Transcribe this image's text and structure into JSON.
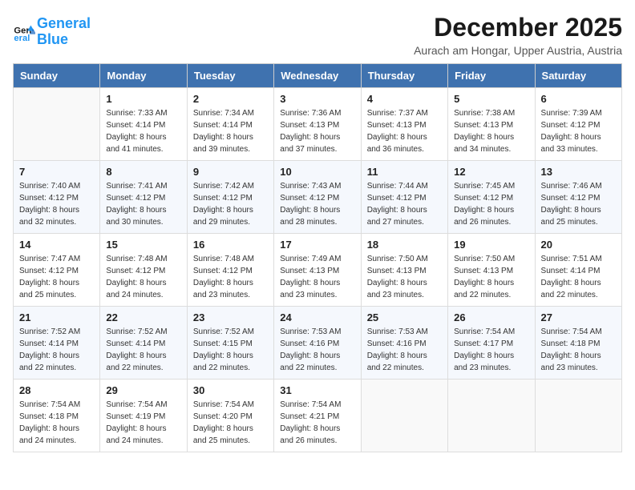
{
  "logo": {
    "line1": "General",
    "line2": "Blue"
  },
  "title": "December 2025",
  "subtitle": "Aurach am Hongar, Upper Austria, Austria",
  "days_of_week": [
    "Sunday",
    "Monday",
    "Tuesday",
    "Wednesday",
    "Thursday",
    "Friday",
    "Saturday"
  ],
  "weeks": [
    [
      {
        "day": "",
        "sunrise": "",
        "sunset": "",
        "daylight": ""
      },
      {
        "day": "1",
        "sunrise": "Sunrise: 7:33 AM",
        "sunset": "Sunset: 4:14 PM",
        "daylight": "Daylight: 8 hours and 41 minutes."
      },
      {
        "day": "2",
        "sunrise": "Sunrise: 7:34 AM",
        "sunset": "Sunset: 4:14 PM",
        "daylight": "Daylight: 8 hours and 39 minutes."
      },
      {
        "day": "3",
        "sunrise": "Sunrise: 7:36 AM",
        "sunset": "Sunset: 4:13 PM",
        "daylight": "Daylight: 8 hours and 37 minutes."
      },
      {
        "day": "4",
        "sunrise": "Sunrise: 7:37 AM",
        "sunset": "Sunset: 4:13 PM",
        "daylight": "Daylight: 8 hours and 36 minutes."
      },
      {
        "day": "5",
        "sunrise": "Sunrise: 7:38 AM",
        "sunset": "Sunset: 4:13 PM",
        "daylight": "Daylight: 8 hours and 34 minutes."
      },
      {
        "day": "6",
        "sunrise": "Sunrise: 7:39 AM",
        "sunset": "Sunset: 4:12 PM",
        "daylight": "Daylight: 8 hours and 33 minutes."
      }
    ],
    [
      {
        "day": "7",
        "sunrise": "Sunrise: 7:40 AM",
        "sunset": "Sunset: 4:12 PM",
        "daylight": "Daylight: 8 hours and 32 minutes."
      },
      {
        "day": "8",
        "sunrise": "Sunrise: 7:41 AM",
        "sunset": "Sunset: 4:12 PM",
        "daylight": "Daylight: 8 hours and 30 minutes."
      },
      {
        "day": "9",
        "sunrise": "Sunrise: 7:42 AM",
        "sunset": "Sunset: 4:12 PM",
        "daylight": "Daylight: 8 hours and 29 minutes."
      },
      {
        "day": "10",
        "sunrise": "Sunrise: 7:43 AM",
        "sunset": "Sunset: 4:12 PM",
        "daylight": "Daylight: 8 hours and 28 minutes."
      },
      {
        "day": "11",
        "sunrise": "Sunrise: 7:44 AM",
        "sunset": "Sunset: 4:12 PM",
        "daylight": "Daylight: 8 hours and 27 minutes."
      },
      {
        "day": "12",
        "sunrise": "Sunrise: 7:45 AM",
        "sunset": "Sunset: 4:12 PM",
        "daylight": "Daylight: 8 hours and 26 minutes."
      },
      {
        "day": "13",
        "sunrise": "Sunrise: 7:46 AM",
        "sunset": "Sunset: 4:12 PM",
        "daylight": "Daylight: 8 hours and 25 minutes."
      }
    ],
    [
      {
        "day": "14",
        "sunrise": "Sunrise: 7:47 AM",
        "sunset": "Sunset: 4:12 PM",
        "daylight": "Daylight: 8 hours and 25 minutes."
      },
      {
        "day": "15",
        "sunrise": "Sunrise: 7:48 AM",
        "sunset": "Sunset: 4:12 PM",
        "daylight": "Daylight: 8 hours and 24 minutes."
      },
      {
        "day": "16",
        "sunrise": "Sunrise: 7:48 AM",
        "sunset": "Sunset: 4:12 PM",
        "daylight": "Daylight: 8 hours and 23 minutes."
      },
      {
        "day": "17",
        "sunrise": "Sunrise: 7:49 AM",
        "sunset": "Sunset: 4:13 PM",
        "daylight": "Daylight: 8 hours and 23 minutes."
      },
      {
        "day": "18",
        "sunrise": "Sunrise: 7:50 AM",
        "sunset": "Sunset: 4:13 PM",
        "daylight": "Daylight: 8 hours and 23 minutes."
      },
      {
        "day": "19",
        "sunrise": "Sunrise: 7:50 AM",
        "sunset": "Sunset: 4:13 PM",
        "daylight": "Daylight: 8 hours and 22 minutes."
      },
      {
        "day": "20",
        "sunrise": "Sunrise: 7:51 AM",
        "sunset": "Sunset: 4:14 PM",
        "daylight": "Daylight: 8 hours and 22 minutes."
      }
    ],
    [
      {
        "day": "21",
        "sunrise": "Sunrise: 7:52 AM",
        "sunset": "Sunset: 4:14 PM",
        "daylight": "Daylight: 8 hours and 22 minutes."
      },
      {
        "day": "22",
        "sunrise": "Sunrise: 7:52 AM",
        "sunset": "Sunset: 4:14 PM",
        "daylight": "Daylight: 8 hours and 22 minutes."
      },
      {
        "day": "23",
        "sunrise": "Sunrise: 7:52 AM",
        "sunset": "Sunset: 4:15 PM",
        "daylight": "Daylight: 8 hours and 22 minutes."
      },
      {
        "day": "24",
        "sunrise": "Sunrise: 7:53 AM",
        "sunset": "Sunset: 4:16 PM",
        "daylight": "Daylight: 8 hours and 22 minutes."
      },
      {
        "day": "25",
        "sunrise": "Sunrise: 7:53 AM",
        "sunset": "Sunset: 4:16 PM",
        "daylight": "Daylight: 8 hours and 22 minutes."
      },
      {
        "day": "26",
        "sunrise": "Sunrise: 7:54 AM",
        "sunset": "Sunset: 4:17 PM",
        "daylight": "Daylight: 8 hours and 23 minutes."
      },
      {
        "day": "27",
        "sunrise": "Sunrise: 7:54 AM",
        "sunset": "Sunset: 4:18 PM",
        "daylight": "Daylight: 8 hours and 23 minutes."
      }
    ],
    [
      {
        "day": "28",
        "sunrise": "Sunrise: 7:54 AM",
        "sunset": "Sunset: 4:18 PM",
        "daylight": "Daylight: 8 hours and 24 minutes."
      },
      {
        "day": "29",
        "sunrise": "Sunrise: 7:54 AM",
        "sunset": "Sunset: 4:19 PM",
        "daylight": "Daylight: 8 hours and 24 minutes."
      },
      {
        "day": "30",
        "sunrise": "Sunrise: 7:54 AM",
        "sunset": "Sunset: 4:20 PM",
        "daylight": "Daylight: 8 hours and 25 minutes."
      },
      {
        "day": "31",
        "sunrise": "Sunrise: 7:54 AM",
        "sunset": "Sunset: 4:21 PM",
        "daylight": "Daylight: 8 hours and 26 minutes."
      },
      {
        "day": "",
        "sunrise": "",
        "sunset": "",
        "daylight": ""
      },
      {
        "day": "",
        "sunrise": "",
        "sunset": "",
        "daylight": ""
      },
      {
        "day": "",
        "sunrise": "",
        "sunset": "",
        "daylight": ""
      }
    ]
  ]
}
